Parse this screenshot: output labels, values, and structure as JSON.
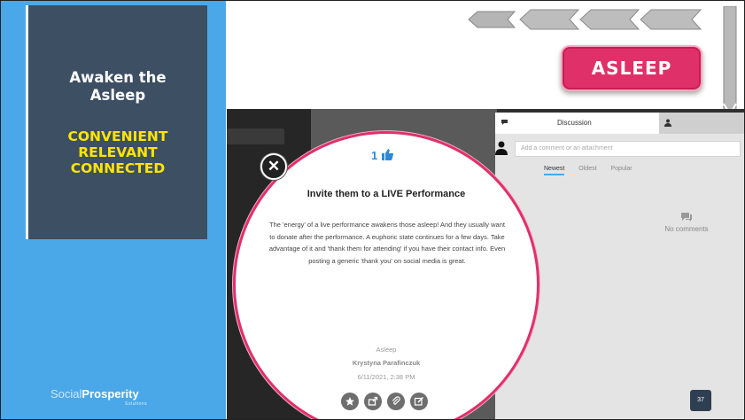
{
  "slide": {
    "title": "Awaken the Asleep",
    "keywords": [
      "CONVENIENT",
      "RELEVANT",
      "CONNECTED"
    ],
    "badge": "ASLEEP",
    "page_number": "37",
    "logo": {
      "part1": "Social",
      "part2": "Prosperity",
      "sub": "Solutions"
    }
  },
  "discussion": {
    "tab_label": "Discussion",
    "comment_placeholder": "Add a comment or an attachment",
    "filters": [
      "Newest",
      "Oldest",
      "Popular"
    ],
    "empty_text": "No comments"
  },
  "card": {
    "likes": "1",
    "title": "Invite them to a LIVE Performance",
    "body": "The 'energy' of a live performance awakens those asleep! And they usually want to donate after the performance. A euphoric state continues for a few days. Take advantage of it and 'thank them for attending' if you have their contact info. Even posting a generic 'thank you' on social media is great.",
    "tag": "Asleep",
    "author": "Krystyna Parafinczuk",
    "date": "6/11/2021, 2:38 PM",
    "close_symbol": "✕"
  },
  "colors": {
    "panel_blue": "#4aa8e8",
    "title_box": "#3d4f63",
    "keyword_yellow": "#ffe500",
    "badge_pink": "#e0306a"
  }
}
